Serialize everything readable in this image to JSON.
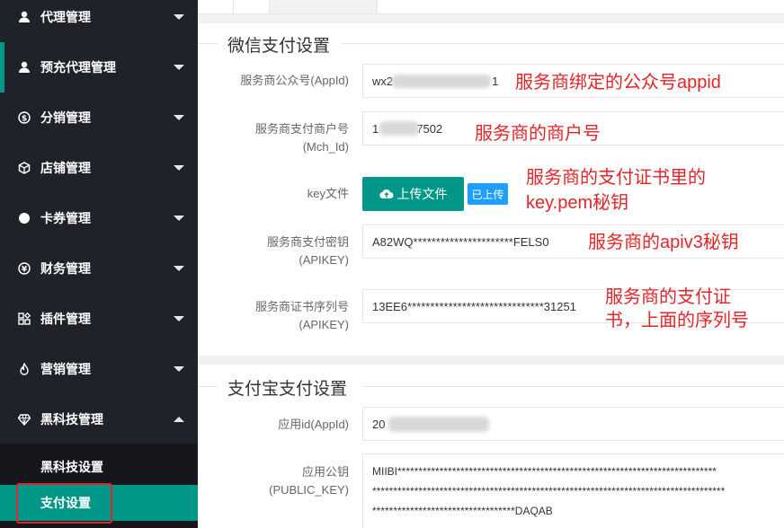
{
  "sidebar": {
    "items": [
      {
        "label": "代理管理",
        "icon": "user-icon"
      },
      {
        "label": "预充代理管理",
        "icon": "user-icon"
      },
      {
        "label": "分销管理",
        "icon": "dollar-icon"
      },
      {
        "label": "店铺管理",
        "icon": "cube-icon"
      },
      {
        "label": "卡券管理",
        "icon": "circle-icon"
      },
      {
        "label": "财务管理",
        "icon": "yen-icon"
      },
      {
        "label": "插件管理",
        "icon": "apps-icon"
      },
      {
        "label": "营销管理",
        "icon": "fire-icon"
      },
      {
        "label": "黑科技管理",
        "icon": "diamond-icon"
      }
    ],
    "submenu": [
      {
        "label": "黑科技设置"
      },
      {
        "label": "支付设置"
      }
    ]
  },
  "wechat": {
    "title": "微信支付设置",
    "appid_label": "服务商公众号(AppId)",
    "appid_value_prefix": "wx2",
    "appid_value_suffix": "1",
    "mchid_label_1": "服务商支付商户号",
    "mchid_label_2": "(Mch_Id)",
    "mchid_value_prefix": "1",
    "mchid_value_suffix": "7502",
    "key_label": "key文件",
    "upload_label": "上传文件",
    "uploaded_label": "已上传",
    "apikey_label_1": "服务商支付密钥",
    "apikey_label_2": "(APIKEY)",
    "apikey_value": "A82WQ**********************FELS0",
    "serial_label_1": "服务商证书序列号",
    "serial_label_2": "(APIKEY)",
    "serial_value": "13EE6******************************31251"
  },
  "alipay": {
    "title": "支付宝支付设置",
    "appid_label": "应用id(AppId)",
    "appid_value_prefix": "20",
    "appid_value_suffix": "",
    "pubkey_label_1": "应用公钥",
    "pubkey_label_2": "(PUBLIC_KEY)",
    "pubkey_value": "MIIBI****************************************************************************\n************************************************************************************\n**********************************DAQAB"
  },
  "annotations": {
    "appid": "服务商绑定的公众号appid",
    "mchid": "服务商的商户号",
    "key_1": "服务商的支付证书里的",
    "key_2": "key.pem秘钥",
    "apiv3": "服务商的apiv3秘钥",
    "serial_1": "服务商的支付证",
    "serial_2": "书，上面的序列号"
  },
  "colors": {
    "accent": "#009688",
    "annotation": "#e0262a",
    "badge": "#1e9fff",
    "sidebar": "#20222a"
  }
}
